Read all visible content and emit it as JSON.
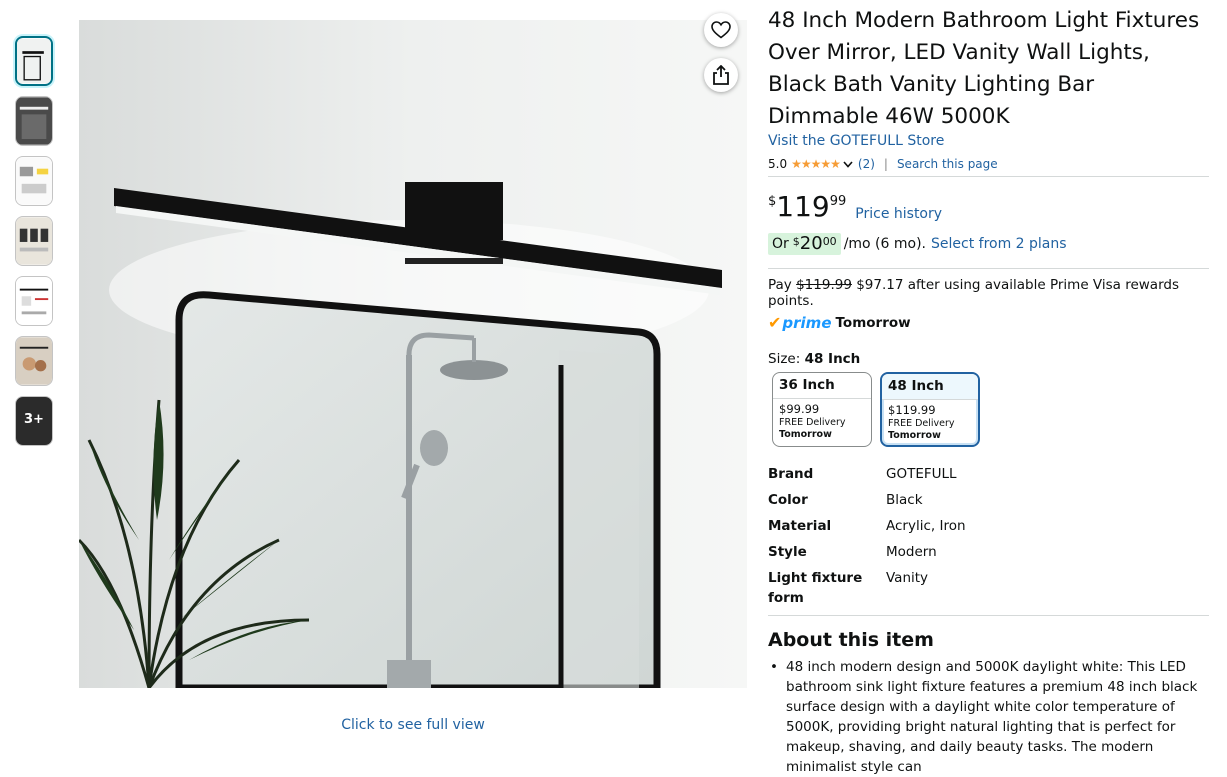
{
  "product": {
    "title": "48 Inch Modern Bathroom Light Fixtures Over Mirror, LED Vanity Wall Lights, Black Bath Vanity Lighting Bar Dimmable 46W 5000K",
    "store_link": "Visit the GOTEFULL Store",
    "rating_value": "5.0",
    "stars": "★★★★★",
    "rating_count": "(2)",
    "search_page": "Search this page"
  },
  "price": {
    "symbol": "$",
    "whole": "119",
    "fraction": "99",
    "history_link": "Price history"
  },
  "monthly": {
    "or": "Or",
    "symbol": "$",
    "amount": "20",
    "fraction": "00",
    "per": "/mo (6 mo).",
    "plans_link": "Select from 2 plans"
  },
  "rewards": {
    "pay": "Pay",
    "old_price": "$119.99",
    "text": "$97.17 after using available Prime Visa rewards points."
  },
  "prime": {
    "check": "✔",
    "label": "prime",
    "delivery": "Tomorrow"
  },
  "size": {
    "label": "Size:",
    "selected": "48 Inch",
    "options": [
      {
        "name": "36 Inch",
        "price": "$99.99",
        "delivery": "FREE Delivery",
        "when": "Tomorrow"
      },
      {
        "name": "48 Inch",
        "price": "$119.99",
        "delivery": "FREE Delivery",
        "when": "Tomorrow"
      }
    ]
  },
  "specs": [
    {
      "key": "Brand",
      "value": "GOTEFULL"
    },
    {
      "key": "Color",
      "value": "Black"
    },
    {
      "key": "Material",
      "value": "Acrylic, Iron"
    },
    {
      "key": "Style",
      "value": "Modern"
    },
    {
      "key": "Light fixture form",
      "value": "Vanity"
    }
  ],
  "about": {
    "heading": "About this item",
    "bullets": [
      "48 inch modern design and 5000K daylight white: This LED bathroom sink light fixture features a premium 48 inch black surface design with a daylight white color temperature of 5000K, providing bright natural lighting that is perfect for makeup, shaving, and daily beauty tasks. The modern minimalist style can"
    ]
  },
  "gallery": {
    "more_label": "3+",
    "full_view": "Click to see full view",
    "heart_icon": "heart-icon",
    "share_icon": "share-icon"
  },
  "colors": {
    "link": "#2162A1",
    "star": "#F69C35",
    "prime_check": "#FF9900",
    "prime_text": "#1A98FF",
    "monthly_bg": "#D7F3DC",
    "selected_border": "#2162A1"
  }
}
